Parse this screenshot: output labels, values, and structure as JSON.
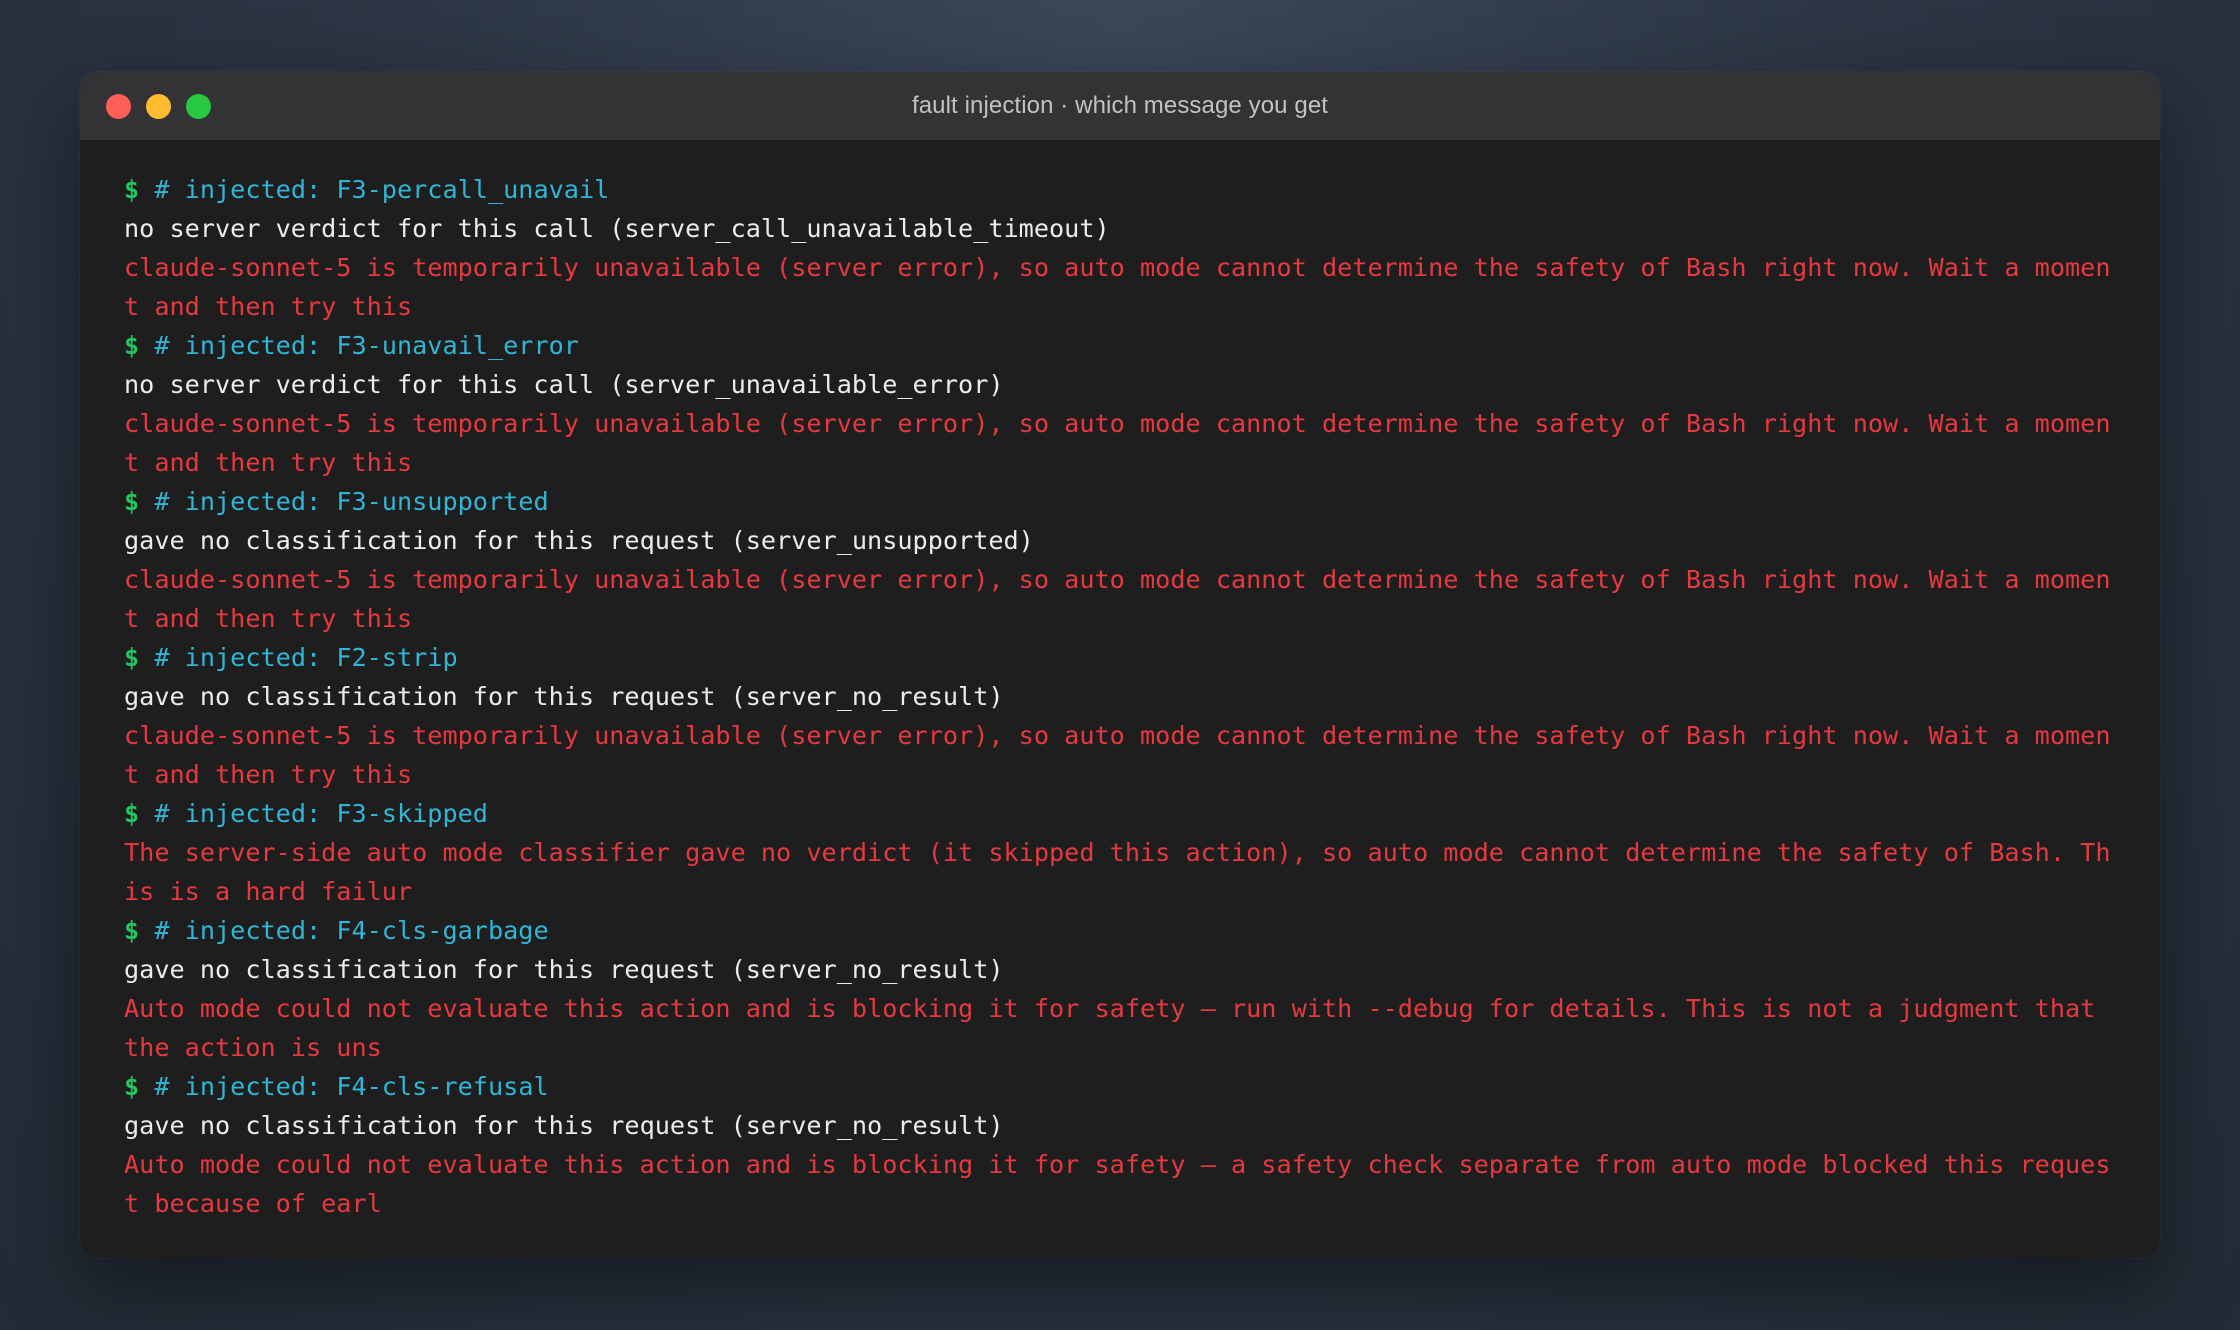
{
  "window": {
    "title": "fault injection · which message you get"
  },
  "blocks": [
    {
      "prompt": "$",
      "command": "# injected: F3-percall_unavail",
      "lines": [
        {
          "style": "white",
          "text": "no server verdict for this call (server_call_unavailable_timeout)"
        },
        {
          "style": "red",
          "text": "claude-sonnet-5 is temporarily unavailable (server error), so auto mode cannot determine the safety of Bash right now. Wait a moment and then try this"
        }
      ]
    },
    {
      "prompt": "$",
      "command": "# injected: F3-unavail_error",
      "lines": [
        {
          "style": "white",
          "text": "no server verdict for this call (server_unavailable_error)"
        },
        {
          "style": "red",
          "text": "claude-sonnet-5 is temporarily unavailable (server error), so auto mode cannot determine the safety of Bash right now. Wait a moment and then try this"
        }
      ]
    },
    {
      "prompt": "$",
      "command": "# injected: F3-unsupported",
      "lines": [
        {
          "style": "white",
          "text": "gave no classification for this request (server_unsupported)"
        },
        {
          "style": "red",
          "text": "claude-sonnet-5 is temporarily unavailable (server error), so auto mode cannot determine the safety of Bash right now. Wait a moment and then try this"
        }
      ]
    },
    {
      "prompt": "$",
      "command": "# injected: F2-strip",
      "lines": [
        {
          "style": "white",
          "text": "gave no classification for this request (server_no_result)"
        },
        {
          "style": "red",
          "text": "claude-sonnet-5 is temporarily unavailable (server error), so auto mode cannot determine the safety of Bash right now. Wait a moment and then try this"
        }
      ]
    },
    {
      "prompt": "$",
      "command": "# injected: F3-skipped",
      "lines": [
        {
          "style": "red",
          "text": "The server-side auto mode classifier gave no verdict (it skipped this action), so auto mode cannot determine the safety of Bash. This is a hard failur"
        }
      ]
    },
    {
      "prompt": "$",
      "command": "# injected: F4-cls-garbage",
      "lines": [
        {
          "style": "white",
          "text": "gave no classification for this request (server_no_result)"
        },
        {
          "style": "red",
          "text": "Auto mode could not evaluate this action and is blocking it for safety — run with --debug for details. This is not a judgment that the action is uns"
        }
      ]
    },
    {
      "prompt": "$",
      "command": "# injected: F4-cls-refusal",
      "lines": [
        {
          "style": "white",
          "text": "gave no classification for this request (server_no_result)"
        },
        {
          "style": "red",
          "text": "Auto mode could not evaluate this action and is blocking it for safety — a safety check separate from auto mode blocked this request because of earl"
        }
      ]
    }
  ]
}
